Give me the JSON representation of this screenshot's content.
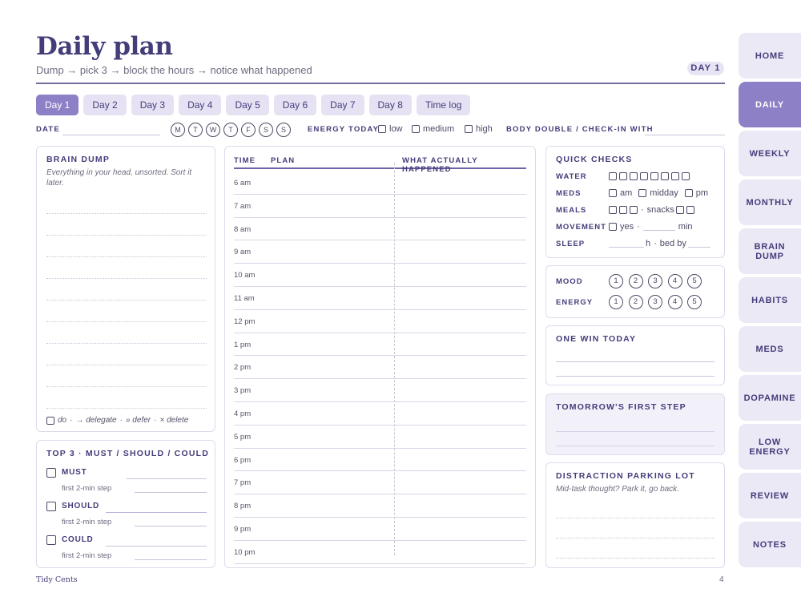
{
  "header": {
    "title": "Daily plan",
    "subtitle": "Dump → pick 3 → block the hours → notice what happened",
    "day_badge": "DAY 1"
  },
  "tabs": [
    "Day 1",
    "Day 2",
    "Day 3",
    "Day 4",
    "Day 5",
    "Day 6",
    "Day 7",
    "Day 8",
    "Time log"
  ],
  "active_tab": "Day 1",
  "meta": {
    "date_label": "DATE",
    "weekdays": [
      "M",
      "T",
      "W",
      "T",
      "F",
      "S",
      "S"
    ],
    "energy_label": "ENERGY TODAY",
    "energy_options": [
      "low",
      "medium",
      "high"
    ],
    "body_double_label": "BODY DOUBLE / CHECK-IN WITH"
  },
  "brain_dump": {
    "title": "BRAIN DUMP",
    "note": "Everything in your head, unsorted. Sort it later.",
    "legend": {
      "do": "do",
      "delegate": "→ delegate",
      "defer": "» defer",
      "delete": "× delete",
      "dot": "·"
    }
  },
  "top3": {
    "title": "TOP 3 · MUST / SHOULD / COULD",
    "items": [
      {
        "label": "MUST",
        "sub": "first 2-min step"
      },
      {
        "label": "SHOULD",
        "sub": "first 2-min step"
      },
      {
        "label": "COULD",
        "sub": "first 2-min step"
      }
    ]
  },
  "schedule": {
    "headers": {
      "time": "TIME",
      "plan": "PLAN",
      "actual": "WHAT ACTUALLY HAPPENED"
    },
    "times": [
      "6 am",
      "7 am",
      "8 am",
      "9 am",
      "10 am",
      "11 am",
      "12 pm",
      "1 pm",
      "2 pm",
      "3 pm",
      "4 pm",
      "5 pm",
      "6 pm",
      "7 pm",
      "8 pm",
      "9 pm",
      "10 pm"
    ]
  },
  "quick_checks": {
    "title": "QUICK CHECKS",
    "water": {
      "label": "WATER",
      "boxes": 8
    },
    "meds": {
      "label": "MEDS",
      "options": [
        "am",
        "midday",
        "pm"
      ]
    },
    "meals": {
      "label": "MEALS",
      "boxes": 3,
      "dot": "·",
      "snacks": "snacks",
      "snack_boxes": 2
    },
    "movement": {
      "label": "MOVEMENT",
      "yes": "yes",
      "dot": "·",
      "unit": "min"
    },
    "sleep": {
      "label": "SLEEP",
      "unit": "h",
      "dot": "·",
      "bed": "bed by"
    }
  },
  "ratings": {
    "mood_label": "MOOD",
    "energy_label": "ENERGY",
    "scale": [
      "1",
      "2",
      "3",
      "4",
      "5"
    ]
  },
  "one_win": {
    "title": "ONE WIN TODAY"
  },
  "tomorrow": {
    "title": "TOMORROW'S FIRST STEP"
  },
  "parking": {
    "title": "DISTRACTION PARKING LOT",
    "note": "Mid-task thought? Park it, go back."
  },
  "footer": {
    "brand": "Tidy Cents",
    "page": "4"
  },
  "sidebar": [
    "HOME",
    "DAILY",
    "WEEKLY",
    "MONTHLY",
    "BRAIN DUMP",
    "HABITS",
    "MEDS",
    "DOPAMINE",
    "LOW ENERGY",
    "REVIEW",
    "NOTES"
  ],
  "sidebar_active": "DAILY",
  "colors": {
    "accent": "#433d7a",
    "tab_active": "#8d80c6",
    "tab_bg": "#e6e2f3",
    "panel_border": "#dedaee"
  }
}
